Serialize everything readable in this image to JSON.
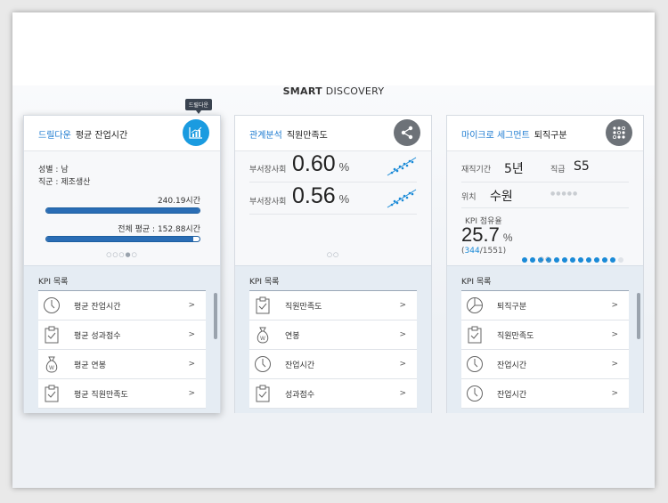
{
  "page": {
    "title_bold": "SMART",
    "title_rest": " DISCOVERY"
  },
  "colors": {
    "accent": "#1a9be0",
    "bar": "#2a6db5",
    "kpi_bg": "#e5ecf3"
  },
  "cards": [
    {
      "category": "드릴다운",
      "name": "평균 잔업시간",
      "button_icon": "chart-icon",
      "tooltip": "드릴다운",
      "info": [
        "성별 : 남",
        "직군 : 제조생산"
      ],
      "bars": [
        {
          "label": "240.19시간",
          "fill": 1.0
        },
        {
          "label": "전체 평균 : 152.88시간",
          "fill": 0.96
        }
      ],
      "pager": "○○○●○",
      "kpi_title": "KPI 목록",
      "kpi_items": [
        {
          "label": "평균 잔업시간",
          "icon": "clock-icon"
        },
        {
          "label": "평균 성과점수",
          "icon": "clipboard-icon"
        },
        {
          "label": "평균 연봉",
          "icon": "money-bag-icon"
        },
        {
          "label": "평균 직원만족도",
          "icon": "clipboard-icon"
        }
      ]
    },
    {
      "category": "관계분석",
      "name": "직원만족도",
      "button_icon": "share-icon",
      "metrics": [
        {
          "label": "부서장사회",
          "value": "0.60",
          "unit": "%"
        },
        {
          "label": "부서장사회",
          "value": "0.56",
          "unit": "%"
        }
      ],
      "pager": "○○",
      "kpi_title": "KPI 목록",
      "kpi_items": [
        {
          "label": "직원만족도",
          "icon": "clipboard-icon"
        },
        {
          "label": "연봉",
          "icon": "money-bag-icon"
        },
        {
          "label": "잔업시간",
          "icon": "clock-icon"
        },
        {
          "label": "성과점수",
          "icon": "clipboard-icon"
        }
      ]
    },
    {
      "category": "마이크로 세그먼트",
      "name": "퇴직구분",
      "button_icon": "segment-icon",
      "tenure_label": "재직기간",
      "tenure_value": "5년",
      "grade_label": "직급",
      "grade_value": "S5",
      "location_label": "위치",
      "location_value": "수원",
      "location_dots": "●●●●●",
      "share_label": "KPI 점유율",
      "share_value": "25.7",
      "share_unit": "%",
      "share_count": "344",
      "share_total": "/1551)",
      "share_open": "(",
      "grid": {
        "highlighted": 12,
        "total": 50
      },
      "pager": "○○",
      "kpi_title": "KPI 목록",
      "kpi_items": [
        {
          "label": "퇴직구분",
          "icon": "pie-chart-icon"
        },
        {
          "label": "직원만족도",
          "icon": "clipboard-icon"
        },
        {
          "label": "잔업시간",
          "icon": "clock-icon"
        },
        {
          "label": "잔업시간",
          "icon": "clock-icon"
        }
      ]
    }
  ]
}
